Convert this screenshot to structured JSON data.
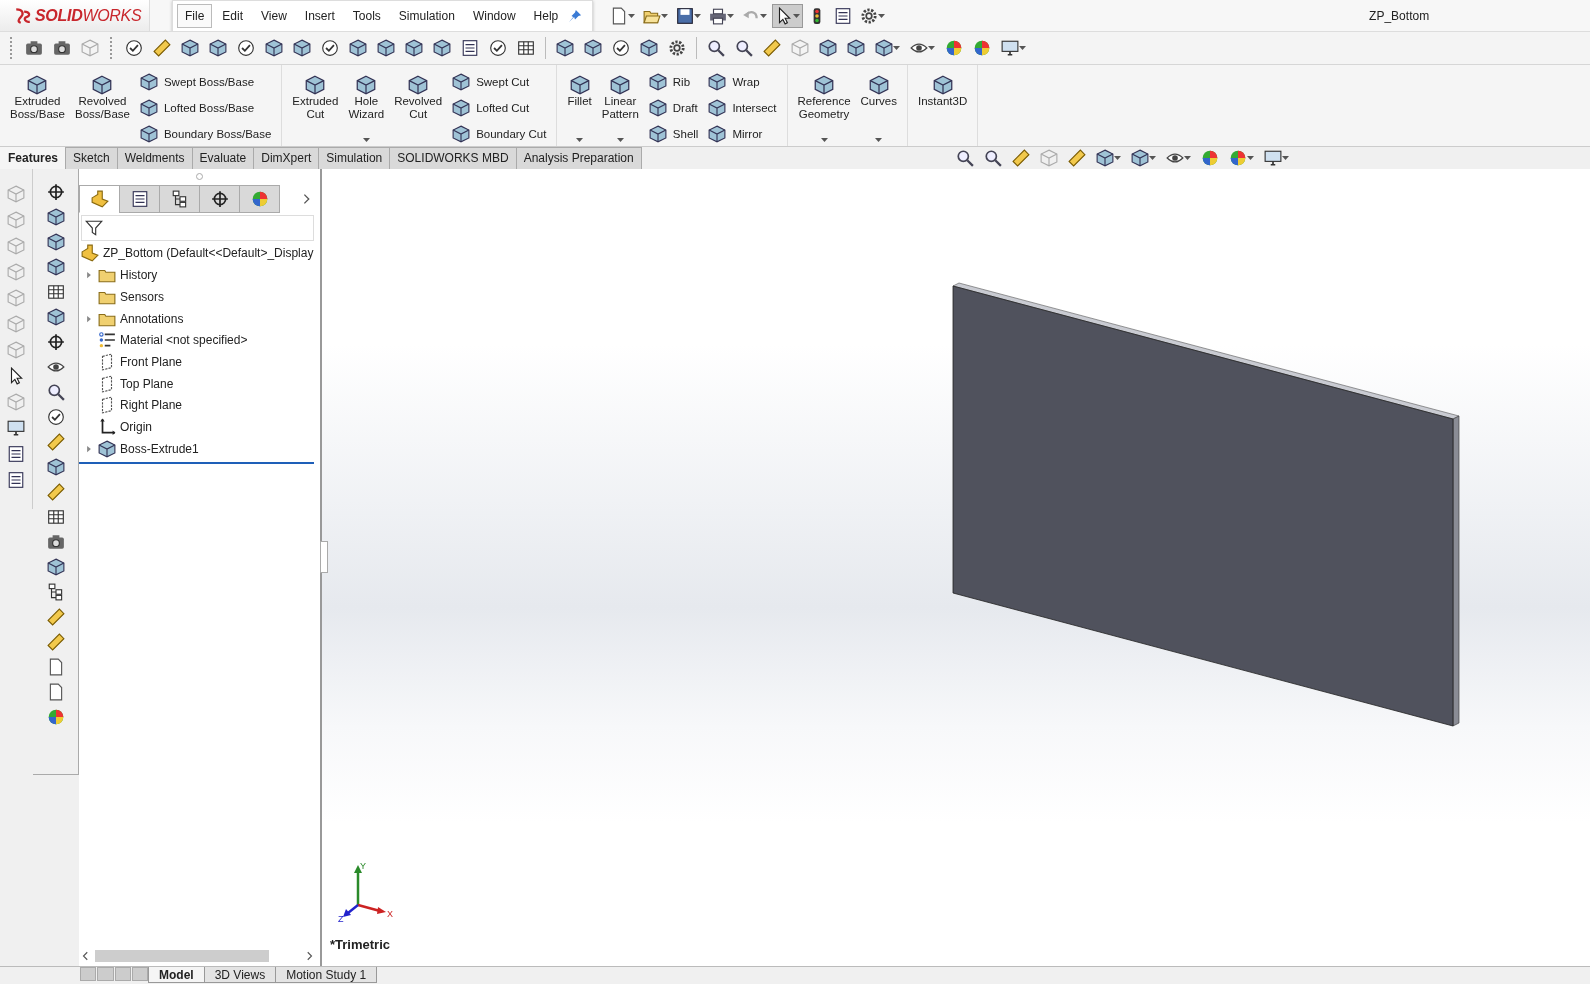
{
  "app": {
    "logo": "**SOLID**WORKS",
    "document_title": "ZP_Bottom"
  },
  "menu": [
    {
      "label": "File",
      "selected": true
    },
    {
      "label": "Edit",
      "selected": false
    },
    {
      "label": "View",
      "selected": false
    },
    {
      "label": "Insert",
      "selected": false
    },
    {
      "label": "Tools",
      "selected": false
    },
    {
      "label": "Simulation",
      "selected": false
    },
    {
      "label": "Window",
      "selected": false
    },
    {
      "label": "Help",
      "selected": false
    }
  ],
  "ribbon": [
    {
      "items": [
        {
          "kind": "large",
          "label": "Extruded Boss/Base",
          "has_menu": false
        },
        {
          "kind": "large",
          "label": "Revolved Boss/Base",
          "has_menu": false
        },
        {
          "kind": "stack",
          "labels": [
            "Swept Boss/Base",
            "Lofted Boss/Base",
            "Boundary Boss/Base"
          ]
        }
      ]
    },
    {
      "items": [
        {
          "kind": "large",
          "label": "Extruded Cut",
          "has_menu": false
        },
        {
          "kind": "large",
          "label": "Hole Wizard",
          "has_menu": true
        },
        {
          "kind": "large",
          "label": "Revolved Cut",
          "has_menu": false
        },
        {
          "kind": "stack",
          "labels": [
            "Swept Cut",
            "Lofted Cut",
            "Boundary Cut"
          ]
        }
      ]
    },
    {
      "items": [
        {
          "kind": "large",
          "label": "Fillet",
          "has_menu": true
        },
        {
          "kind": "large",
          "label": "Linear Pattern",
          "has_menu": true
        },
        {
          "kind": "stack",
          "labels": [
            "Rib",
            "Draft",
            "Shell"
          ]
        },
        {
          "kind": "stack",
          "labels": [
            "Wrap",
            "Intersect",
            "Mirror"
          ]
        }
      ]
    },
    {
      "items": [
        {
          "kind": "large",
          "label": "Reference Geometry",
          "has_menu": true
        },
        {
          "kind": "large",
          "label": "Curves",
          "has_menu": true
        }
      ]
    },
    {
      "items": [
        {
          "kind": "large",
          "label": "Instant3D",
          "has_menu": false
        }
      ]
    }
  ],
  "command_tabs": [
    {
      "label": "Features",
      "selected": true
    },
    {
      "label": "Sketch",
      "selected": false
    },
    {
      "label": "Weldments",
      "selected": false
    },
    {
      "label": "Evaluate",
      "selected": false
    },
    {
      "label": "DimXpert",
      "selected": false
    },
    {
      "label": "Simulation",
      "selected": false
    },
    {
      "label": "SOLIDWORKS MBD",
      "selected": false
    },
    {
      "label": "Analysis Preparation",
      "selected": false
    }
  ],
  "panel_tabs": [
    {
      "selected": true
    },
    {
      "selected": false
    },
    {
      "selected": false
    },
    {
      "selected": false
    },
    {
      "selected": false
    }
  ],
  "tree": {
    "label": "ZP_Bottom  (Default<<Default>_Display",
    "children": [
      {
        "label": "History",
        "kind": "history",
        "expandable": true
      },
      {
        "label": "Sensors",
        "kind": "sensors",
        "expandable": false
      },
      {
        "label": "Annotations",
        "kind": "annotations",
        "expandable": true
      },
      {
        "label": "Material <not specified>",
        "kind": "material",
        "expandable": false
      },
      {
        "label": "Front Plane",
        "kind": "plane",
        "expandable": false
      },
      {
        "label": "Top Plane",
        "kind": "plane",
        "expandable": false
      },
      {
        "label": "Right Plane",
        "kind": "plane",
        "expandable": false
      },
      {
        "label": "Origin",
        "kind": "origin",
        "expandable": false
      },
      {
        "label": "Boss-Extrude1",
        "kind": "feature",
        "expandable": true
      }
    ]
  },
  "viewport": {
    "view_name": "*Trimetric",
    "axes": [
      "Y",
      "X",
      "Z"
    ]
  },
  "bottom_tabs": [
    {
      "label": "Model",
      "selected": true
    },
    {
      "label": "3D Views",
      "selected": false
    },
    {
      "label": "Motion Study 1",
      "selected": false
    }
  ]
}
